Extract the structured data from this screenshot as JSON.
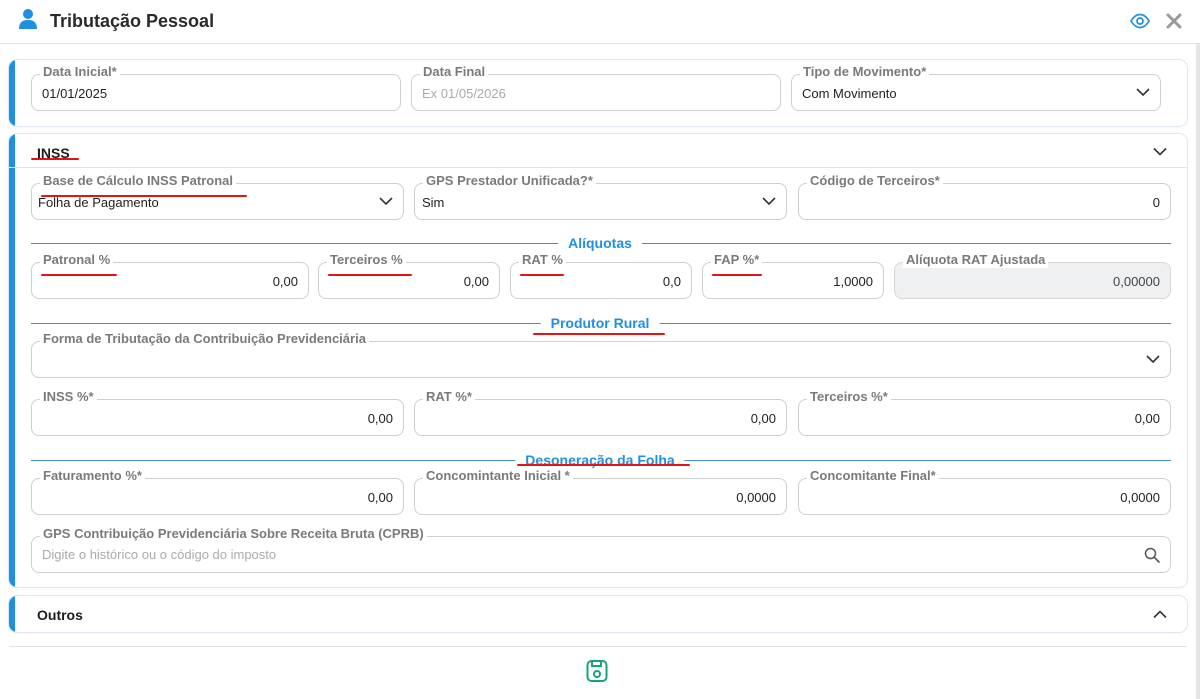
{
  "window": {
    "title": "Tributação Pessoal"
  },
  "top": {
    "data_inicial": {
      "label": "Data Inicial*",
      "value": "01/01/2025"
    },
    "data_final": {
      "label": "Data Final",
      "placeholder": "Ex 01/05/2026"
    },
    "tipo_movimento": {
      "label": "Tipo de Movimento*",
      "value": "Com Movimento"
    }
  },
  "inss": {
    "title": "INSS",
    "base_calculo": {
      "label": "Base de Cálculo INSS Patronal",
      "value": "Folha de Pagamento"
    },
    "gps_prestador": {
      "label": "GPS Prestador Unificada?*",
      "value": "Sim"
    },
    "codigo_terceiros": {
      "label": "Código de Terceiros*",
      "value": "0"
    },
    "aliquotas_title": "Alíquotas",
    "patronal": {
      "label": "Patronal %",
      "value": "0,00"
    },
    "terceiros": {
      "label": "Terceiros %",
      "value": "0,00"
    },
    "rat": {
      "label": "RAT %",
      "value": "0,0"
    },
    "fap": {
      "label": "FAP %*",
      "value": "1,0000"
    },
    "aliquota_rat": {
      "label": "Alíquota RAT Ajustada",
      "value": "0,00000"
    },
    "produtor_title": "Produtor Rural",
    "forma_tributacao": {
      "label": "Forma de Tributação da Contribuição Previdenciária",
      "value": ""
    },
    "pr_inss": {
      "label": "INSS %*",
      "value": "0,00"
    },
    "pr_rat": {
      "label": "RAT %*",
      "value": "0,00"
    },
    "pr_terceiros": {
      "label": "Terceiros %*",
      "value": "0,00"
    },
    "desoneracao_title": "Desoneração da Folha",
    "faturamento": {
      "label": "Faturamento %*",
      "value": "0,00"
    },
    "conc_inicial": {
      "label": "Concomintante Inicial *",
      "value": "0,0000"
    },
    "conc_final": {
      "label": "Concomitante Final*",
      "value": "0,0000"
    },
    "gps_cprb": {
      "label": "GPS Contribuição Previdenciária Sobre Receita Bruta (CPRB)",
      "placeholder": "Digite o histórico ou o código do imposto"
    }
  },
  "outros": {
    "title": "Outros"
  },
  "colors": {
    "accent": "#1e8fe1",
    "annotation": "#e01515",
    "save": "#1aa37a"
  }
}
